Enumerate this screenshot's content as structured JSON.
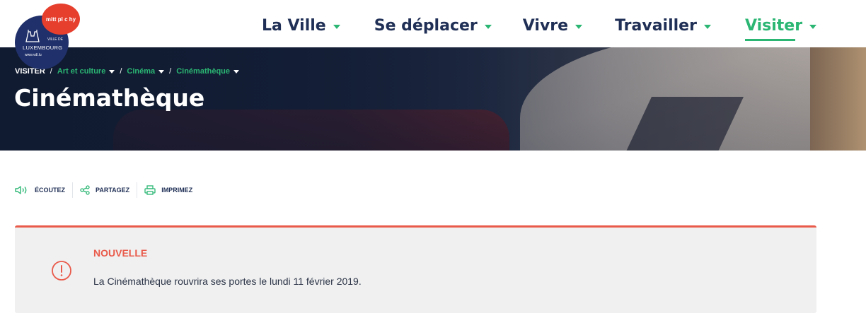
{
  "logo": {
    "bubble_text": "mitt pl c hy",
    "small_text": "VILLE DE",
    "name": "LUXEMBOURG",
    "url": "www.vdl.lu"
  },
  "nav": {
    "items": [
      {
        "label": "La Ville"
      },
      {
        "label": "Se déplacer"
      },
      {
        "label": "Vivre"
      },
      {
        "label": "Travailler"
      },
      {
        "label": "Visiter",
        "active": true
      }
    ]
  },
  "breadcrumb": {
    "items": [
      "VISITER",
      "Art et culture",
      "Cinéma",
      "Cinémathèque"
    ],
    "separator": "/"
  },
  "page_title": "Cinémathèque",
  "toolbar": {
    "listen_label": "ÉCOUTEZ",
    "share_label": "PARTAGEZ",
    "print_label": "IMPRIMEZ"
  },
  "notice": {
    "title": "NOUVELLE",
    "text": "La Cinémathèque rouvrira ses portes le lundi 11 février 2019."
  },
  "colors": {
    "brand_green": "#2bb673",
    "navy": "#1f2f55",
    "alert_red": "#e95a4a",
    "logo_red": "#e63f2e",
    "logo_blue": "#20306a"
  },
  "icons": {
    "listen": "speaker-icon",
    "share": "share-icon",
    "print": "printer-icon",
    "notice": "exclamation-circle-icon",
    "dropdown": "chevron-down-icon"
  }
}
